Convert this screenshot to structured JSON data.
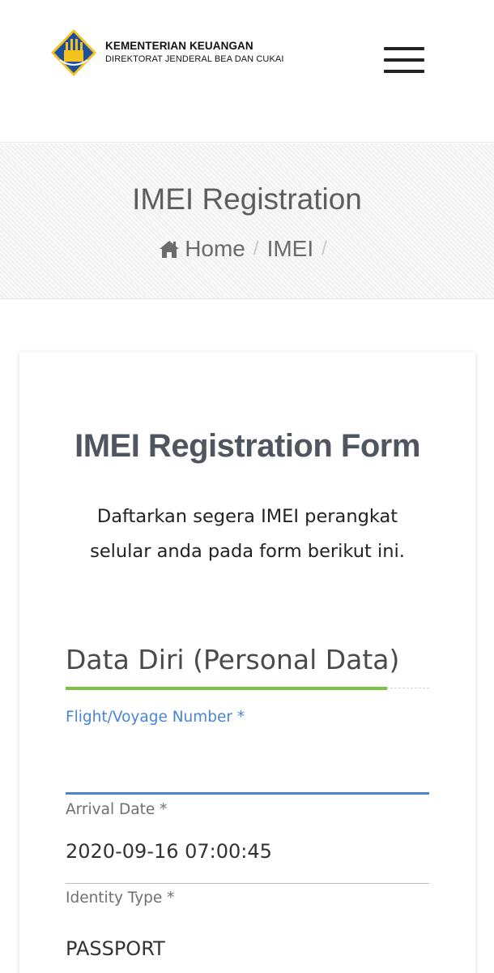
{
  "header": {
    "org_title": "KEMENTERIAN KEUANGAN",
    "org_subtitle": "DIREKTORAT JENDERAL BEA DAN CUKAI",
    "menu_icon": "hamburger-menu-icon"
  },
  "page_header": {
    "title": "IMEI Registration",
    "breadcrumb": [
      {
        "label": "Home",
        "icon": "home-icon"
      },
      {
        "label": "IMEI"
      }
    ],
    "separator": "/"
  },
  "form": {
    "title": "IMEI Registration Form",
    "description": "Daftarkan segera IMEI perangkat selular anda pada form berikut ini.",
    "section_title": "Data Diri (Personal Data)",
    "fields": {
      "flight": {
        "label": "Flight/Voyage Number *",
        "value": ""
      },
      "arrival": {
        "label": "Arrival Date *",
        "value": "2020-09-16 07:00:45"
      },
      "identity": {
        "label": "Identity Type *",
        "value": "PASSPORT"
      }
    }
  },
  "colors": {
    "accent_blue": "#4a85d0",
    "accent_green": "#7cc142",
    "title_gray": "#4f5660"
  }
}
